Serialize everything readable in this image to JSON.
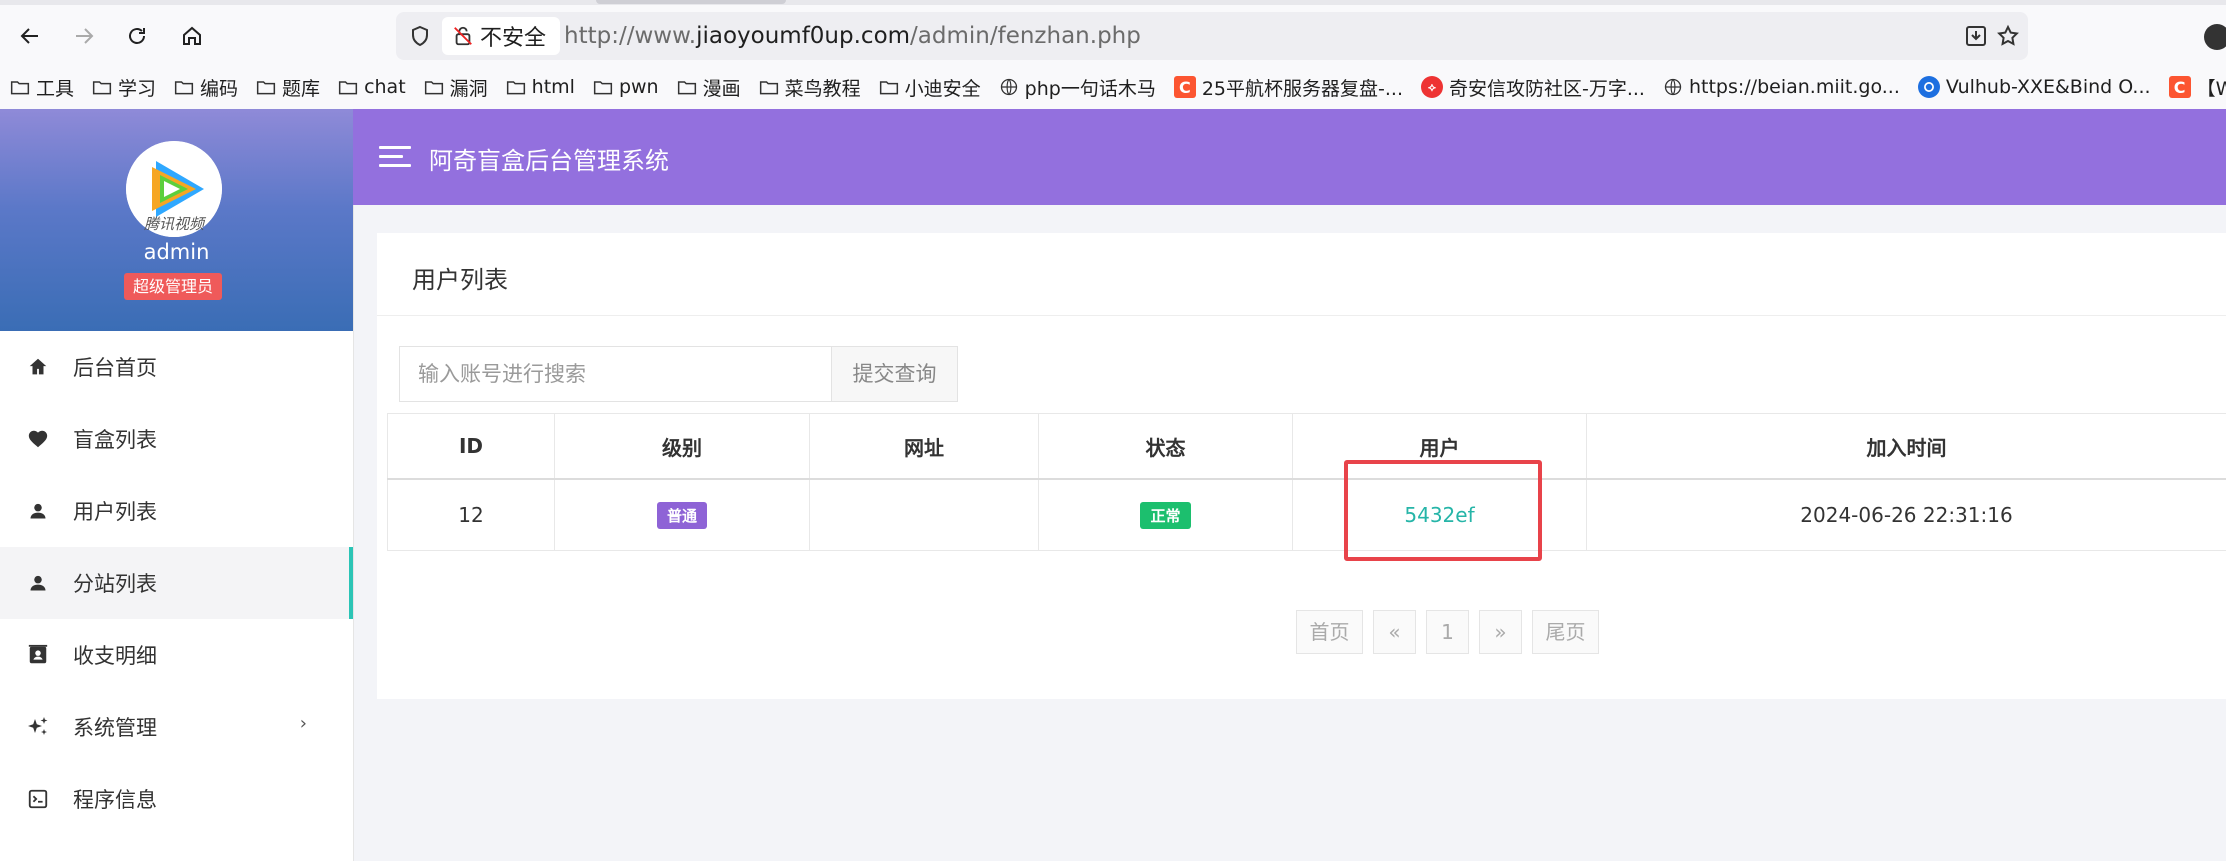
{
  "browser": {
    "url_insecure_label": "不安全",
    "url_prefix": "http://www.",
    "url_host": "jiaoyoumf0up.com",
    "url_path": "/admin/fenzhan.php",
    "bookmarks": [
      {
        "label": "工具",
        "icon": "folder-icon"
      },
      {
        "label": "学习",
        "icon": "folder-icon"
      },
      {
        "label": "编码",
        "icon": "folder-icon"
      },
      {
        "label": "题库",
        "icon": "folder-icon"
      },
      {
        "label": "chat",
        "icon": "folder-icon"
      },
      {
        "label": "漏洞",
        "icon": "folder-icon"
      },
      {
        "label": "html",
        "icon": "folder-icon"
      },
      {
        "label": "pwn",
        "icon": "folder-icon"
      },
      {
        "label": "漫画",
        "icon": "folder-icon"
      },
      {
        "label": "菜鸟教程",
        "icon": "folder-icon"
      },
      {
        "label": "小迪安全",
        "icon": "folder-icon"
      },
      {
        "label": "php一句话木马",
        "icon": "globe-icon"
      },
      {
        "label": "25平航杯服务器复盘-...",
        "icon": "csdn-favicon"
      },
      {
        "label": "奇安信攻防社区-万字...",
        "icon": "qianxin-favicon"
      },
      {
        "label": "https://beian.miit.go...",
        "icon": "globe-icon"
      },
      {
        "label": "Vulhub-XXE&Bind O...",
        "icon": "vulhub-favicon"
      },
      {
        "label": "【Web",
        "icon": "csdn-favicon"
      }
    ]
  },
  "sidebar": {
    "avatar_caption": "腾讯视频",
    "username": "admin",
    "role": "超级管理员",
    "items": [
      {
        "label": "后台首页",
        "icon": "home-icon"
      },
      {
        "label": "盲盒列表",
        "icon": "heart-icon"
      },
      {
        "label": "用户列表",
        "icon": "person-icon"
      },
      {
        "label": "分站列表",
        "icon": "person-icon",
        "active": true
      },
      {
        "label": "收支明细",
        "icon": "contact-card-icon"
      },
      {
        "label": "系统管理",
        "icon": "sparkle-icon",
        "chevron": "›"
      },
      {
        "label": "程序信息",
        "icon": "terminal-icon"
      }
    ]
  },
  "header": {
    "title": "阿奇盲盒后台管理系统"
  },
  "main": {
    "card_title": "用户列表",
    "search_placeholder": "输入账号进行搜索",
    "search_button": "提交查询",
    "columns": [
      "ID",
      "级别",
      "网址",
      "状态",
      "用户",
      "加入时间"
    ],
    "rows": [
      {
        "id": "12",
        "level": "普通",
        "url": "",
        "status": "正常",
        "user": "5432ef",
        "joined": "2024-06-26 22:31:16"
      }
    ],
    "pagination": {
      "first": "首页",
      "prev": "«",
      "current": "1",
      "next": "»",
      "last": "尾页"
    }
  },
  "colors": {
    "header_bg": "#9370de",
    "active_indicator": "#2bc4b6",
    "level_badge": "#8e63d6",
    "status_badge": "#1cbf6e",
    "user_link": "#26b5a8",
    "highlight_box": "#e8434a"
  }
}
